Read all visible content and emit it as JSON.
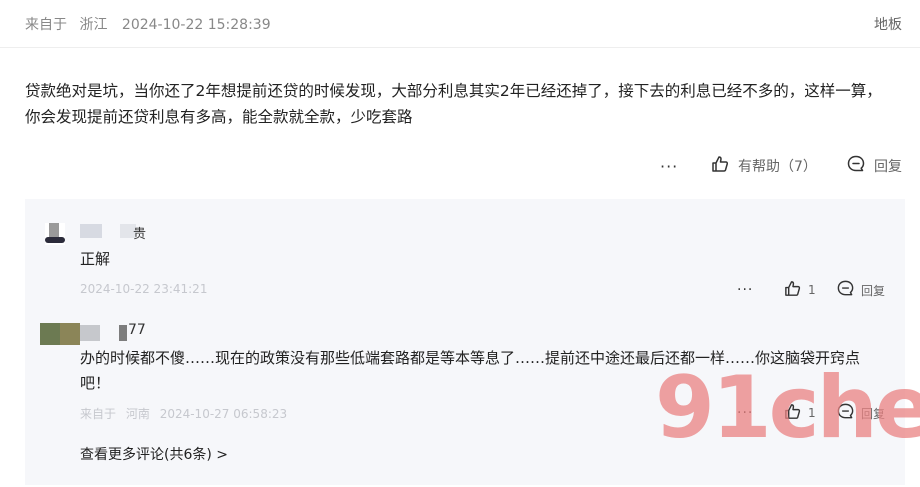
{
  "meta": {
    "from_label": "来自于",
    "location": "浙江",
    "time": "2024-10-22 15:28:39",
    "user": "地板"
  },
  "comment": {
    "text": "贷款绝对是坑，当你还了2年想提前还贷的时候发现，大部分利息其实2年已经还掉了，接下去的利息已经不多的，这样一算，你会发现提前还贷利息有多高，能全款就全款，少吃套路",
    "more_label": "···",
    "helpful_label": "有帮助（7）",
    "reply_label": "回复"
  },
  "replies": [
    {
      "name_visible": "贵",
      "text": "正解",
      "time": "2024-10-22 23:41:21",
      "more_label": "···",
      "like_count": "1",
      "reply_label": "回复"
    },
    {
      "name_visible": "77",
      "text": "办的时候都不傻……现在的政策没有那些低端套路都是等本等息了……提前还中途还最后还都一样……你这脑袋开窍点吧！",
      "from_label": "来自于",
      "location": "河南",
      "time": "2024-10-27 06:58:23",
      "more_label": "···",
      "like_count": "1",
      "reply_label": "回复"
    }
  ],
  "more_comments_label": "查看更多评论(共6条) >",
  "watermark": "91che",
  "icons": {
    "like": "thumbs-up-icon",
    "reply": "comment-bubble-icon",
    "more": "more-dots-icon"
  }
}
